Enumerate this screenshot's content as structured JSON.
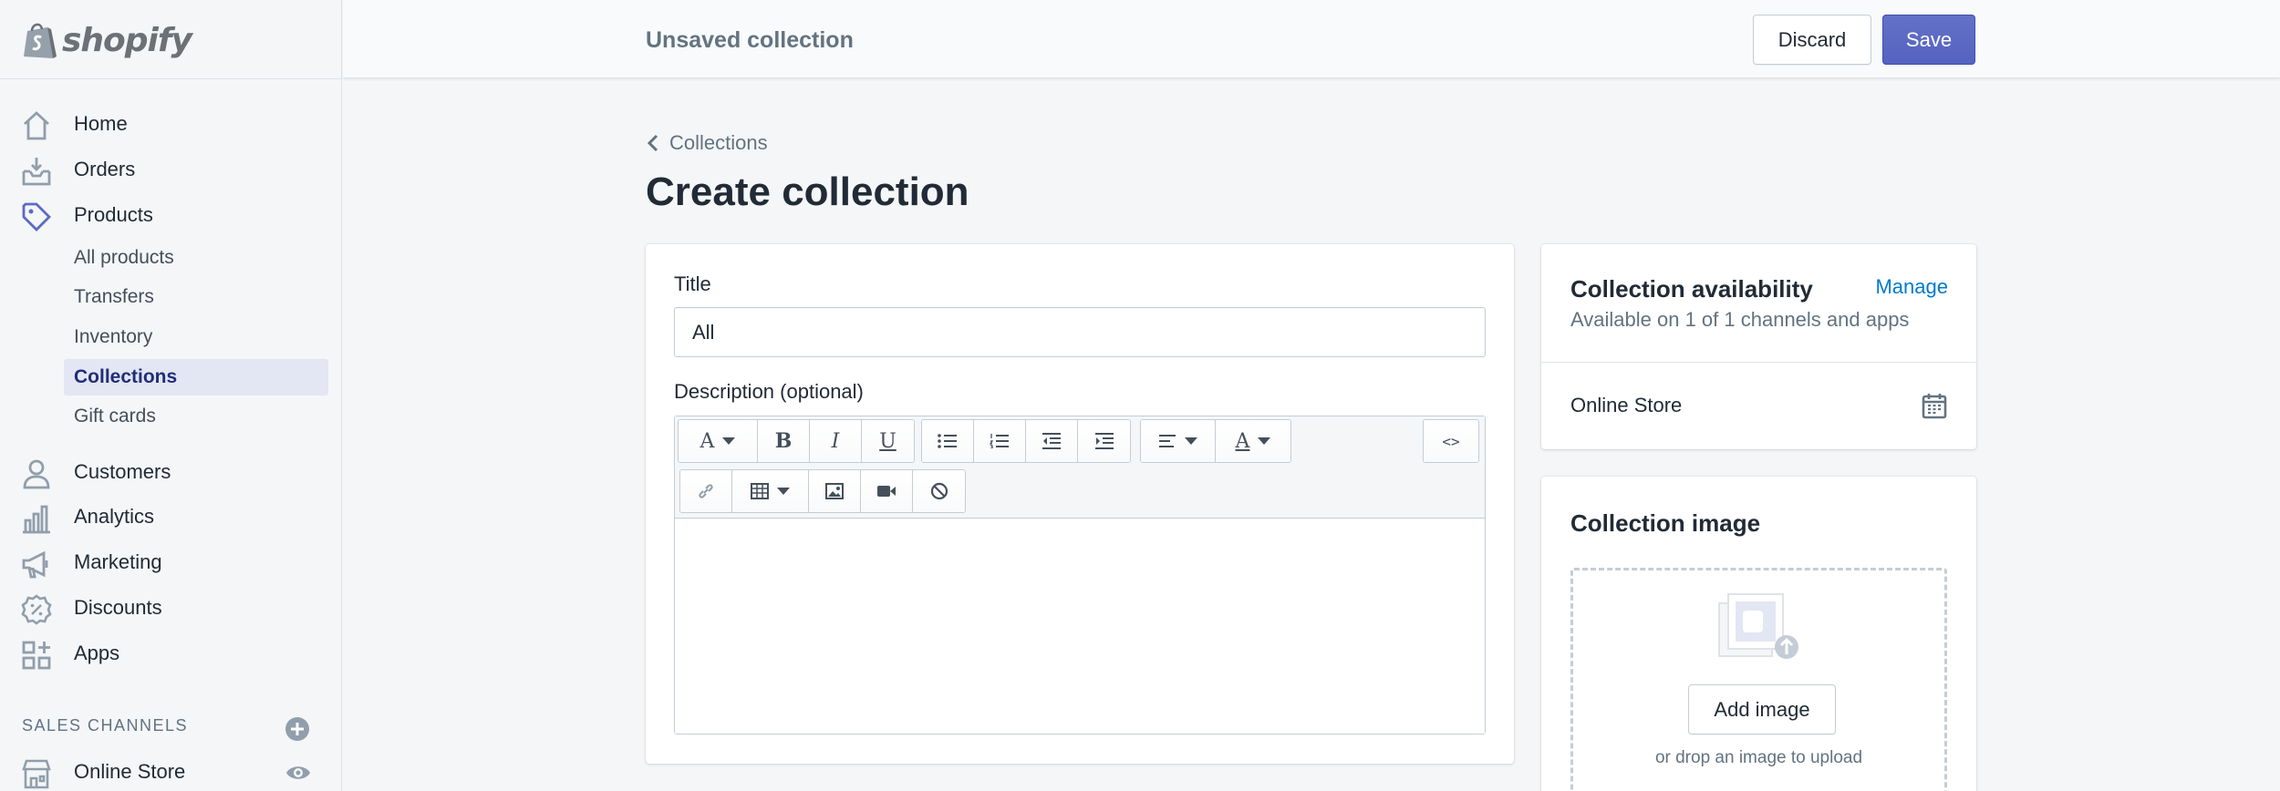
{
  "brand": {
    "name": "shopify"
  },
  "nav": {
    "home": "Home",
    "orders": "Orders",
    "products": "Products",
    "products_sub": [
      "All products",
      "Transfers",
      "Inventory",
      "Collections",
      "Gift cards"
    ],
    "customers": "Customers",
    "analytics": "Analytics",
    "marketing": "Marketing",
    "discounts": "Discounts",
    "apps": "Apps",
    "sales_channels_heading": "SALES CHANNELS",
    "online_store": "Online Store"
  },
  "topbar": {
    "title": "Unsaved collection",
    "discard_label": "Discard",
    "save_label": "Save"
  },
  "page": {
    "breadcrumb": "Collections",
    "title": "Create collection"
  },
  "form": {
    "title_label": "Title",
    "title_value": "All",
    "description_label": "Description (optional)",
    "toolbar_code_label": "<>"
  },
  "availability": {
    "title": "Collection availability",
    "manage_label": "Manage",
    "subtitle": "Available on 1 of 1 channels and apps",
    "channel": "Online Store"
  },
  "collection_image": {
    "title": "Collection image",
    "add_label": "Add image",
    "hint": "or drop an image to upload"
  },
  "colors": {
    "accent": "#5c6ac4",
    "link": "#007ace",
    "nav_icon": "#919eab",
    "active_bg": "#e3e6f3"
  }
}
